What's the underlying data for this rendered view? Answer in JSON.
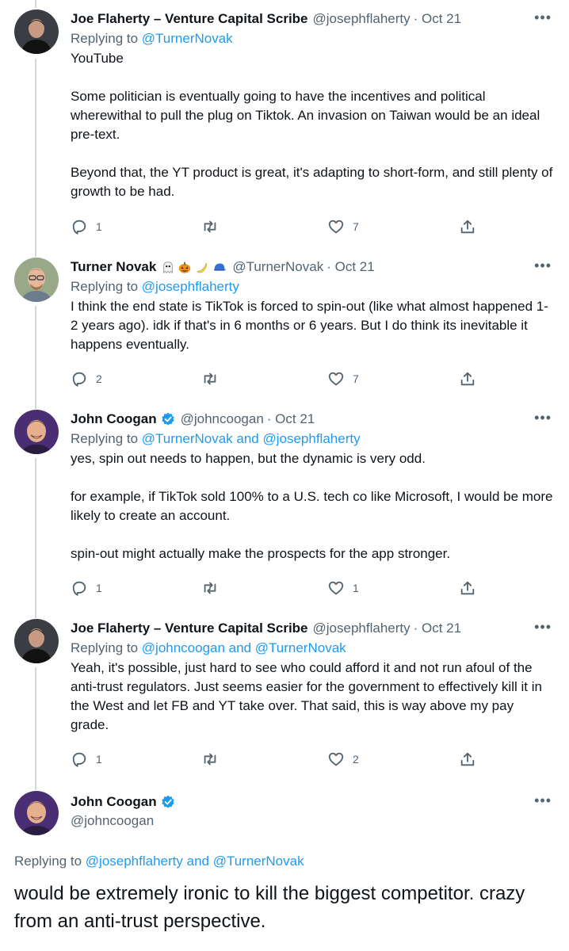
{
  "tweets": [
    {
      "name": "Joe Flaherty – Venture Capital Scribe",
      "handle": "@josephflaherty",
      "date": "· Oct 21",
      "replying_prefix": "Replying to ",
      "replying_to": "@TurnerNovak",
      "replying_and": "",
      "replying_to_2": "",
      "text": "YouTube\n\nSome politician is eventually going to have the incentives and political wherewithal to pull the plug on Tiktok. An invasion on Taiwan would be an ideal pre-text.\n\nBeyond that, the YT product is great, it's adapting to short-form, and still plenty of growth to be had.",
      "reply_count": "1",
      "retweet_count": "",
      "like_count": "7"
    },
    {
      "name": "Turner Novak",
      "handle": "@TurnerNovak",
      "date": "· Oct 21",
      "replying_prefix": "Replying to ",
      "replying_to": "@josephflaherty",
      "replying_and": "",
      "replying_to_2": "",
      "text": "I think the end state is TikTok is forced to spin-out (like what almost happened 1-2 years ago). idk if that's in 6 months or 6 years. But I do think its inevitable it happens eventually.",
      "reply_count": "2",
      "retweet_count": "",
      "like_count": "7"
    },
    {
      "name": "John Coogan",
      "handle": "@johncoogan",
      "date": "· Oct 21",
      "replying_prefix": "Replying to ",
      "replying_to": "@TurnerNovak",
      "replying_and": " and ",
      "replying_to_2": "@josephflaherty",
      "text": "yes, spin out needs to happen, but the dynamic is very odd.\n\nfor example, if TikTok sold 100% to a U.S. tech co like Microsoft, I would be more likely to create an account.\n\nspin-out might actually make the prospects for the app stronger.",
      "reply_count": "1",
      "retweet_count": "",
      "like_count": "1"
    },
    {
      "name": "Joe Flaherty – Venture Capital Scribe",
      "handle": "@josephflaherty",
      "date": "· Oct 21",
      "replying_prefix": "Replying to ",
      "replying_to": "@johncoogan",
      "replying_and": " and ",
      "replying_to_2": "@TurnerNovak",
      "text": "Yeah, it's possible, just hard to see who could afford it and not run afoul of the anti-trust regulators. Just seems easier for the government to effectively kill it in the West and let FB and YT take over. That said, this is way above my pay grade.",
      "reply_count": "1",
      "retweet_count": "",
      "like_count": "2"
    }
  ],
  "main": {
    "name": "John Coogan",
    "handle": "@johncoogan",
    "replying_prefix": "Replying to ",
    "replying_to": "@josephflaherty",
    "replying_and": " and ",
    "replying_to_2": "@TurnerNovak",
    "text": "would be extremely ironic to kill the biggest competitor. crazy from an anti-trust perspective."
  },
  "icons": {
    "more": "more-dots-icon",
    "reply": "reply-icon",
    "retweet": "retweet-icon",
    "like": "heart-icon",
    "share": "share-icon",
    "verified": "verified-badge-icon",
    "turner_emojis": [
      "ghost-emoji",
      "pumpkin-emoji",
      "banana-emoji",
      "blue-cap-emoji"
    ]
  },
  "colors": {
    "link": "#1d9bf0",
    "secondary": "#536471",
    "thread_line": "#cfd9de",
    "text": "#0f1419"
  }
}
